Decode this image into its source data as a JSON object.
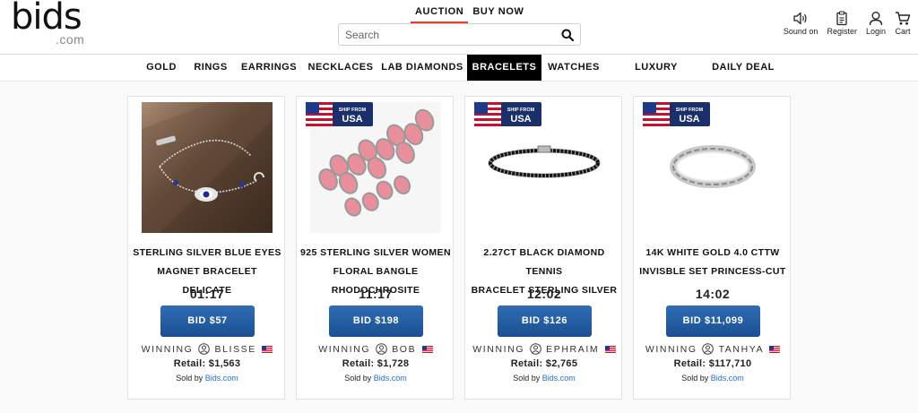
{
  "header": {
    "logo_main": "bids",
    "logo_sub": ".com",
    "mode_tabs": [
      {
        "label": "AUCTION",
        "active": true
      },
      {
        "label": "BUY NOW",
        "active": false
      }
    ],
    "search": {
      "placeholder": "Search",
      "value": ""
    },
    "utils": [
      {
        "icon": "speaker-icon",
        "label": "Sound on"
      },
      {
        "icon": "clipboard-icon",
        "label": "Register"
      },
      {
        "icon": "user-icon",
        "label": "Login"
      },
      {
        "icon": "cart-icon",
        "label": "Cart"
      }
    ]
  },
  "categories": [
    {
      "label": "GOLD",
      "active": false
    },
    {
      "label": "RINGS",
      "active": false
    },
    {
      "label": "EARRINGS",
      "active": false
    },
    {
      "label": "NECKLACES",
      "active": false
    },
    {
      "label": "LAB DIAMONDS",
      "active": false
    },
    {
      "label": "BRACELETS",
      "active": true
    },
    {
      "label": "WATCHES",
      "active": false
    },
    {
      "label": "LUXURY WATCHES",
      "active": false
    },
    {
      "label": "DAILY DEAL",
      "active": false
    }
  ],
  "badge": {
    "ship_text": "SHIP FROM",
    "country": "USA"
  },
  "products": [
    {
      "title_line1": "STERLING SILVER BLUE EYES",
      "title_line2": "MAGNET BRACELET DELICATE",
      "timer": "01:17",
      "bid": "BID $57",
      "winning_label": "WINNING",
      "winner": "BLISSE",
      "retail": "Retail:  $1,563",
      "sold_by_label": "Sold by",
      "sold_by": "Bids.com",
      "ship_from_usa": false
    },
    {
      "title_line1": "925 STERLING SILVER WOMEN",
      "title_line2": "FLORAL BANGLE RHODOCHROSITE",
      "timer": "11:17",
      "bid": "BID $198",
      "winning_label": "WINNING",
      "winner": "BOB",
      "retail": "Retail:  $1,728",
      "sold_by_label": "Sold by",
      "sold_by": "Bids.com",
      "ship_from_usa": true
    },
    {
      "title_line1": "2.27CT BLACK DIAMOND TENNIS",
      "title_line2": "BRACELET STERLING SILVER",
      "timer": "12:02",
      "bid": "BID $126",
      "winning_label": "WINNING",
      "winner": "EPHRAIM",
      "retail": "Retail:  $2,765",
      "sold_by_label": "Sold by",
      "sold_by": "Bids.com",
      "ship_from_usa": true
    },
    {
      "title_line1": "14K WHITE GOLD 4.0 CTTW",
      "title_line2": "INVISBLE SET PRINCESS-CUT",
      "timer": "14:02",
      "bid": "BID $11,099",
      "winning_label": "WINNING",
      "winner": "TANHYA",
      "retail": "Retail:  $117,710",
      "sold_by_label": "Sold by",
      "sold_by": "Bids.com",
      "ship_from_usa": true
    }
  ],
  "colors": {
    "bid_button": "#1f5ba3",
    "active_tab_underline": "#e0402a",
    "link": "#1f6fd0",
    "active_category_bg": "#000000"
  }
}
